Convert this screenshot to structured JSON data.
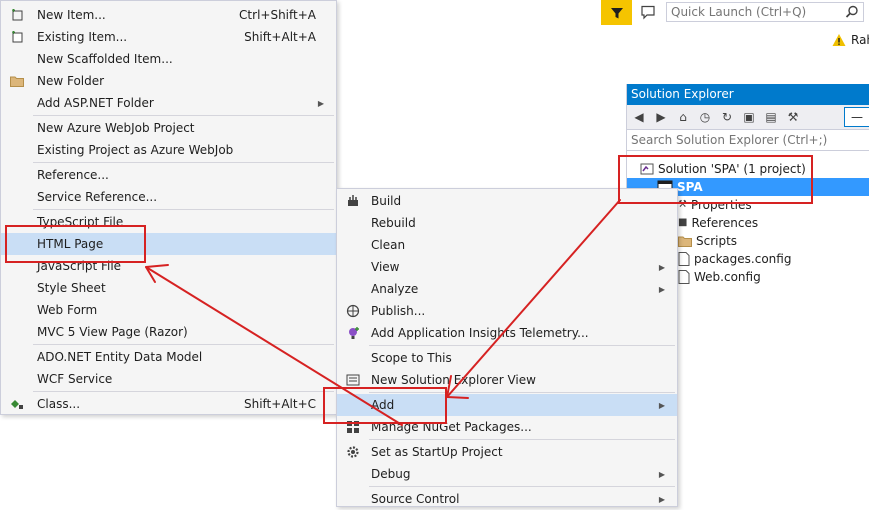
{
  "topbar": {
    "quick_launch_placeholder": "Quick Launch (Ctrl+Q)",
    "user_name_partial": "Rah",
    "filter_color": "#f5c400"
  },
  "solution_explorer": {
    "title": "Solution Explorer",
    "search_placeholder": "Search Solution Explorer (Ctrl+;)",
    "tree": [
      {
        "label": "Solution 'SPA' (1 project)",
        "icon": "solution-icon"
      },
      {
        "label": "SPA",
        "icon": "project-icon",
        "selected": true
      },
      {
        "label": "Properties",
        "icon": "wrench-icon"
      },
      {
        "label": "References",
        "icon": "references-icon"
      },
      {
        "label": "Scripts",
        "icon": "folder-icon"
      },
      {
        "label": "packages.config",
        "icon": "config-file-icon"
      },
      {
        "label": "Web.config",
        "icon": "config-file-icon"
      }
    ],
    "title_color": "#007acc",
    "selection_color": "#3399ff"
  },
  "add_submenu": {
    "items": [
      {
        "label": "New Item...",
        "shortcut": "Ctrl+Shift+A"
      },
      {
        "label": "Existing Item...",
        "shortcut": "Shift+Alt+A"
      },
      {
        "label": "New Scaffolded Item..."
      },
      {
        "label": "New Folder"
      },
      {
        "label": "Add ASP.NET Folder"
      },
      {
        "label": "New Azure WebJob Project"
      },
      {
        "label": "Existing Project as Azure WebJob"
      },
      {
        "label": "Reference..."
      },
      {
        "label": "Service Reference..."
      },
      {
        "label": "TypeScript File"
      },
      {
        "label": "HTML Page"
      },
      {
        "label": "JavaScript File"
      },
      {
        "label": "Style Sheet"
      },
      {
        "label": "Web Form"
      },
      {
        "label": "MVC 5 View Page (Razor)"
      },
      {
        "label": "ADO.NET Entity Data Model"
      },
      {
        "label": "WCF Service"
      },
      {
        "label": "Class...",
        "shortcut": "Shift+Alt+C"
      }
    ]
  },
  "project_context_menu": {
    "items": [
      {
        "label": "Build"
      },
      {
        "label": "Rebuild"
      },
      {
        "label": "Clean"
      },
      {
        "label": "View"
      },
      {
        "label": "Analyze"
      },
      {
        "label": "Publish..."
      },
      {
        "label": "Add Application Insights Telemetry..."
      },
      {
        "label": "Scope to This"
      },
      {
        "label": "New Solution Explorer View"
      },
      {
        "label": "Add"
      },
      {
        "label": "Manage NuGet Packages..."
      },
      {
        "label": "Set as StartUp Project"
      },
      {
        "label": "Debug"
      },
      {
        "label": "Source Control"
      }
    ]
  },
  "colors": {
    "annotation_red": "#d62222",
    "menu_highlight": "#c9def5"
  }
}
